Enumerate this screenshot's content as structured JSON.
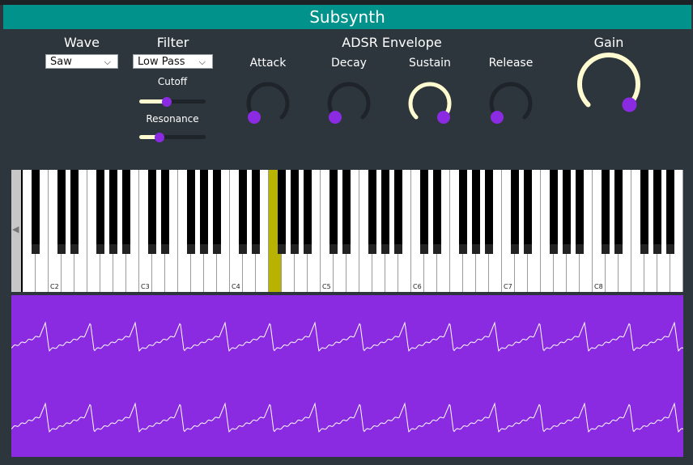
{
  "app": {
    "title": "Subsynth"
  },
  "wave": {
    "label": "Wave",
    "selected": "Saw"
  },
  "filter": {
    "label": "Filter",
    "selected": "Low Pass",
    "cutoff": {
      "label": "Cutoff",
      "value": 0.4
    },
    "resonance": {
      "label": "Resonance",
      "value": 0.27
    }
  },
  "envelope": {
    "label": "ADSR Envelope",
    "attack": {
      "label": "Attack",
      "value": 0.0
    },
    "decay": {
      "label": "Decay",
      "value": 0.0
    },
    "sustain": {
      "label": "Sustain",
      "value": 1.0
    },
    "release": {
      "label": "Release",
      "value": 0.0
    }
  },
  "gain": {
    "label": "Gain",
    "value": 1.0
  },
  "keyboard": {
    "octave_labels": [
      "C2",
      "C3",
      "C4",
      "C5",
      "C6",
      "C7",
      "C8"
    ],
    "pressed_key": "F4"
  },
  "colors": {
    "accent": "#8a2be2",
    "arc": "#fffbd0",
    "title_bar": "#00928b",
    "pressed_key": "#b8b200",
    "background": "#2e363d"
  },
  "icons": {
    "dropdown": "chevron-down-icon",
    "scroll": "triangle-left-icon"
  }
}
